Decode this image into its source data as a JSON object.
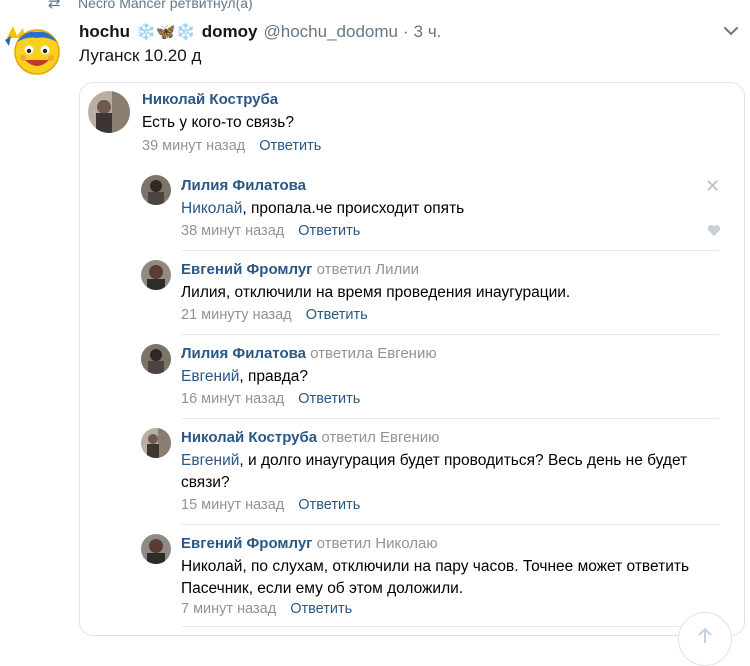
{
  "retweet": {
    "text": "Necro Mancer ретвитнул(а)"
  },
  "tweet": {
    "name": "hochu",
    "name_emoji": "❄️🦋❄️",
    "name_suffix": "domoy",
    "handle": "@hochu_dodomu",
    "dot": "·",
    "time": "3 ч.",
    "text": "Луганск 10.20 д"
  },
  "card": {
    "comments": [
      {
        "author": "Николай Коструба",
        "replied": "",
        "mention": "",
        "text": "Есть у кого-то связь?",
        "time": "39 минут назад",
        "reply_label": "Ответить"
      },
      {
        "author": "Лилия Филатова",
        "replied": "",
        "mention": "Николай",
        "text": ", пропала.че происходит опять",
        "time": "38 минут назад",
        "reply_label": "Ответить",
        "close_glyph": "✕"
      },
      {
        "author": "Евгений Фромлуг",
        "replied": "ответил Лилии",
        "mention": "",
        "text": "Лилия, отключили на время проведения инаугурации.",
        "time": "21 минуту назад",
        "reply_label": "Ответить"
      },
      {
        "author": "Лилия Филатова",
        "replied": "ответила Евгению",
        "mention": "Евгений",
        "text": ", правда?",
        "time": "16 минут назад",
        "reply_label": "Ответить"
      },
      {
        "author": "Николай Коструба",
        "replied": "ответил Евгению",
        "mention": "Евгений",
        "text": ", и долго инаугурация будет проводиться? Весь день не будет связи?",
        "time": "15 минут назад",
        "reply_label": "Ответить"
      },
      {
        "author": "Евгений Фромлуг",
        "replied": "ответил Николаю",
        "mention": "",
        "text": "Николай, по слухам, отключили на пару часов. Точнее может ответить Пасечник, если ему об этом доложили.",
        "time": "7 минут назад",
        "reply_label": "Ответить"
      }
    ]
  },
  "colors": {
    "link": "#2a5885",
    "muted": "#939393",
    "twitter_muted": "#657786",
    "separator": "#e7e8ec"
  },
  "icons": {
    "retweet": "retweet-icon",
    "caret": "chevron-down-icon",
    "close": "close-icon",
    "like": "heart-icon",
    "scroll": "scroll-up-icon"
  }
}
